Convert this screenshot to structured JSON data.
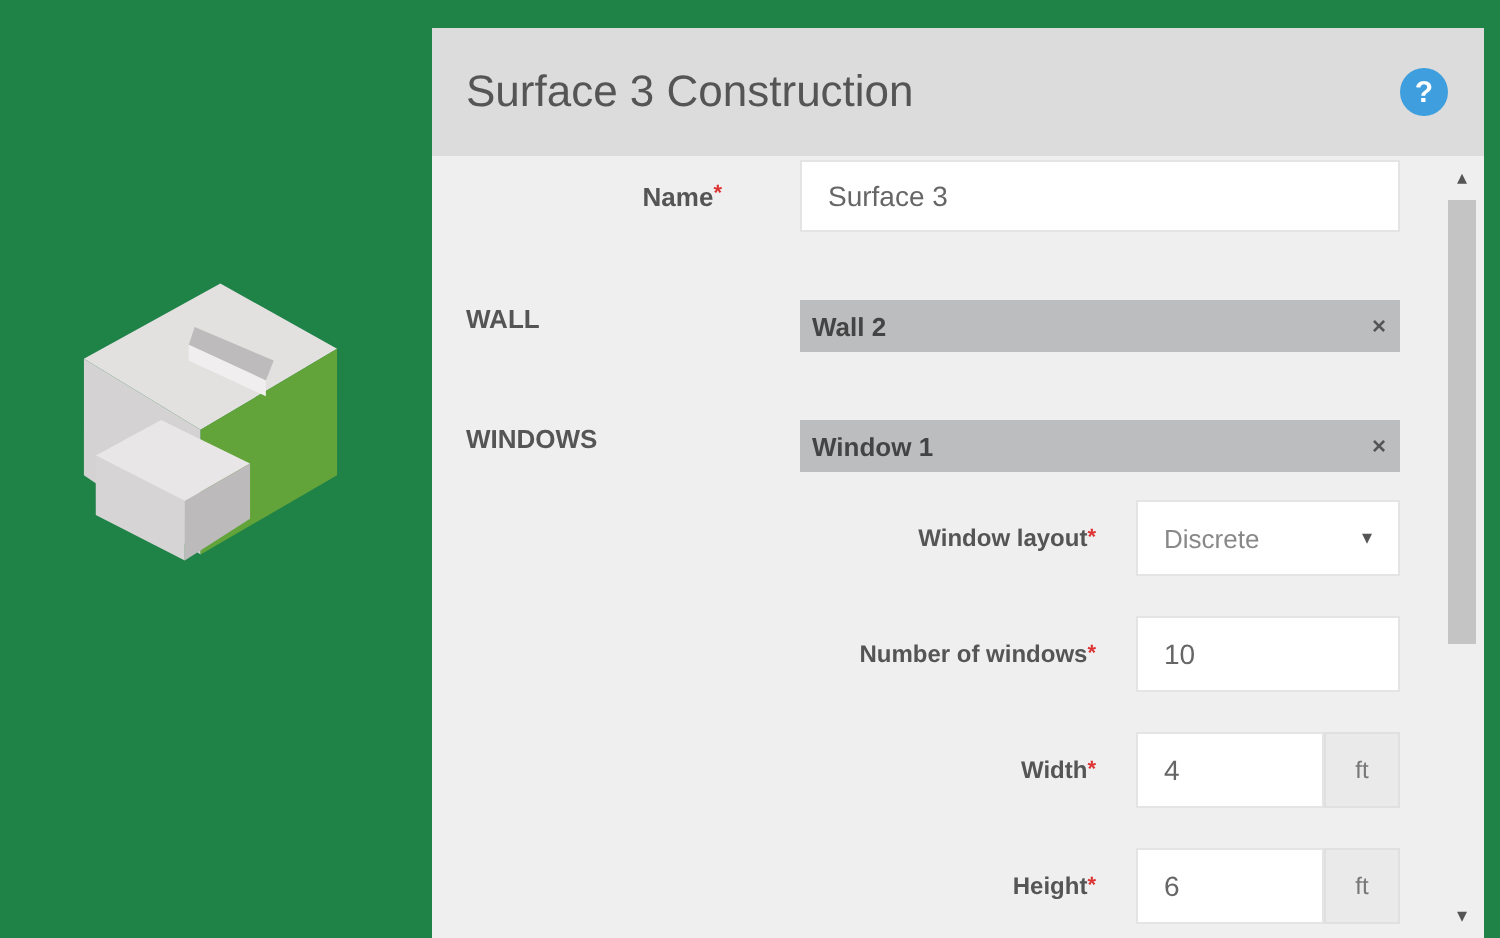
{
  "panel": {
    "title": "Surface 3 Construction",
    "help_icon": "?"
  },
  "name_field": {
    "label": "Name",
    "required_mark": "*",
    "value": "Surface 3"
  },
  "sections": [
    {
      "label": "WALL",
      "tag": "Wall 2",
      "remove": "×"
    },
    {
      "label": "WINDOWS",
      "tag": "Window 1",
      "remove": "×"
    }
  ],
  "window_fields": [
    {
      "kind": "select",
      "label": "Window layout",
      "required_mark": "*",
      "value": "Discrete",
      "caret": "▾"
    },
    {
      "kind": "input",
      "label": "Number of windows",
      "required_mark": "*",
      "value": "10"
    },
    {
      "kind": "unit",
      "label": "Width",
      "required_mark": "*",
      "value": "4",
      "unit": "ft"
    },
    {
      "kind": "unit",
      "label": "Height",
      "required_mark": "*",
      "value": "6",
      "unit": "ft"
    }
  ],
  "scrollbar": {
    "up": "▴",
    "down": "▾"
  }
}
